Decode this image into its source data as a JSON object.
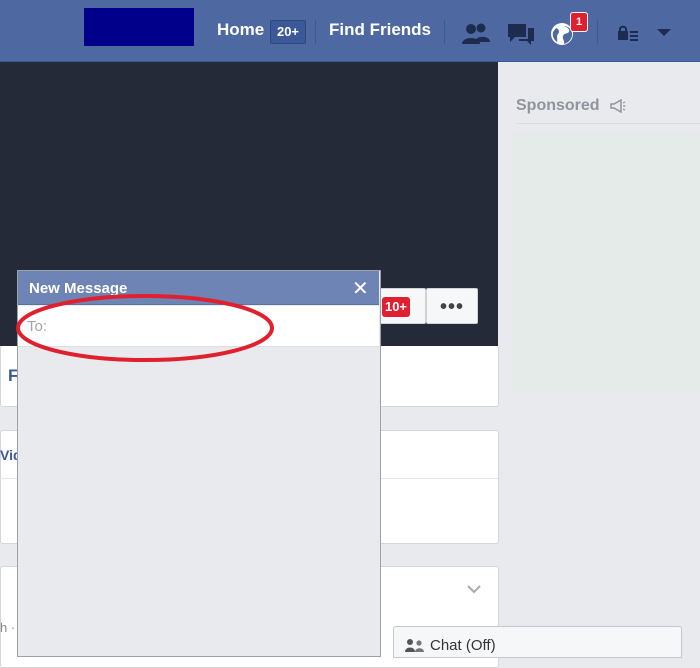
{
  "header": {
    "nav_home": "Home",
    "nav_home_count": "20+",
    "nav_find_friends": "Find Friends",
    "notification_count": "1"
  },
  "cover": {
    "notification_pill": "10+",
    "more_button": "•••"
  },
  "left_panels": {
    "panel1_initial": "F",
    "panel2_label": "Vid",
    "panel3_label": "h ·"
  },
  "sidebar": {
    "sponsored_label": "Sponsored"
  },
  "chat": {
    "label": "Chat (Off)"
  },
  "new_message": {
    "title": "New Message",
    "close": "✕",
    "to_label": "To:",
    "to_value": ""
  },
  "colors": {
    "topbar": "#4e69a2",
    "message_header": "#6d84b4",
    "annotation": "#e0202f"
  }
}
